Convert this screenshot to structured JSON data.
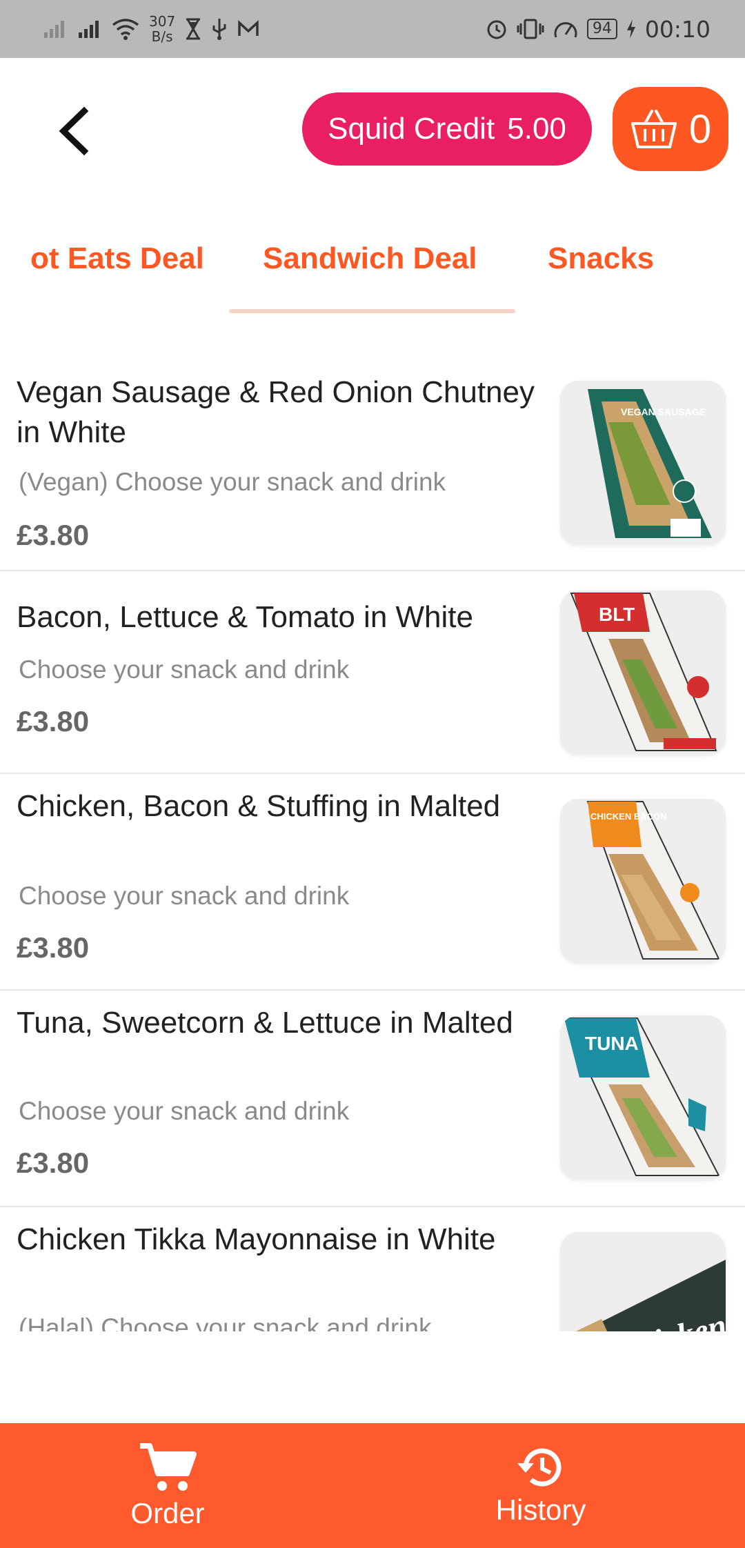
{
  "status_bar": {
    "speed_value": "307",
    "speed_unit": "B/s",
    "battery": "94",
    "time": "00:10"
  },
  "header": {
    "credit_label": "Squid Credit",
    "credit_value": "5.00",
    "cart_count": "0"
  },
  "tabs": [
    {
      "label": "Hot Eats Deal",
      "visible_text": "ot Eats Deal"
    },
    {
      "label": "Sandwich Deal",
      "selected": true
    },
    {
      "label": "Snacks"
    }
  ],
  "products": [
    {
      "name": "Vegan Sausage & Red Onion Chutney in White",
      "desc": "(Vegan) Choose your snack and drink",
      "price": "£3.80",
      "pack_title": "VEGAN SAUSAGE",
      "pack_color": "#1f6b5b"
    },
    {
      "name": "Bacon, Lettuce & Tomato in White",
      "desc": "Choose your snack and drink",
      "price": "£3.80",
      "pack_title": "BLT",
      "pack_color": "#d32f2f"
    },
    {
      "name": "Chicken, Bacon & Stuffing in Malted",
      "desc": "Choose your snack and drink",
      "price": "£3.80",
      "pack_title": "CHICKEN BACON",
      "pack_color": "#ef8a1d"
    },
    {
      "name": "Tuna, Sweetcorn & Lettuce in Malted",
      "desc": "Choose your snack and drink",
      "price": "£3.80",
      "pack_title": "TUNA",
      "pack_color": "#1d8fa3"
    },
    {
      "name": "Chicken Tikka Mayonnaise in White",
      "desc": "(Halal) Choose your snack and drink",
      "price": "",
      "pack_title": "Chicken",
      "pack_color": "#2d3b36"
    }
  ],
  "bottom_nav": {
    "order_label": "Order",
    "history_label": "History"
  },
  "colors": {
    "accent": "#ff5722",
    "credit_pink": "#e91e63",
    "status_bar": "#b9b9b9"
  },
  "icons": [
    "signal-icon",
    "wifi-icon",
    "hourglass-icon",
    "usb-icon",
    "mail-icon",
    "alarm-icon",
    "vibrate-icon",
    "speedometer-icon",
    "battery-icon",
    "charging-icon",
    "back-arrow-icon",
    "basket-icon",
    "cart-icon",
    "history-icon"
  ]
}
